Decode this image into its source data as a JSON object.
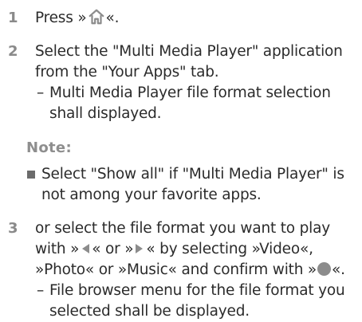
{
  "steps": [
    {
      "number": "1",
      "pre": "Press »",
      "post": "«."
    },
    {
      "number": "2",
      "lines": [
        "Select the \"Multi Media Player\" application",
        "from the \"Your Apps\" tab."
      ],
      "result_lines": [
        "Multi Media Player file format selection",
        "shall displayed."
      ]
    },
    {
      "number": "3",
      "line1": "or select the file format you want to play",
      "line2_a": "with »",
      "line2_b": "« or »",
      "line2_c": "« by selecting »Video«,",
      "line3_a": "»Photo« or »Music« and confirm with »",
      "line3_b": "«.",
      "result_lines": [
        "File browser menu for the file format you",
        "selected shall be displayed."
      ]
    }
  ],
  "note": {
    "title": "Note:",
    "lines": [
      "Select \"Show all\" if \"Multi Media Player\" is",
      "not among your favorite apps."
    ]
  },
  "result_dash": "–",
  "icons": {
    "home": "home-icon",
    "left": "left-arrow-icon",
    "right": "right-arrow-icon",
    "ok": "ok-circle-icon"
  },
  "colors": {
    "text": "#2b2b2b",
    "step_number": "#8a8a8a",
    "icon": "#8c8c8c"
  }
}
